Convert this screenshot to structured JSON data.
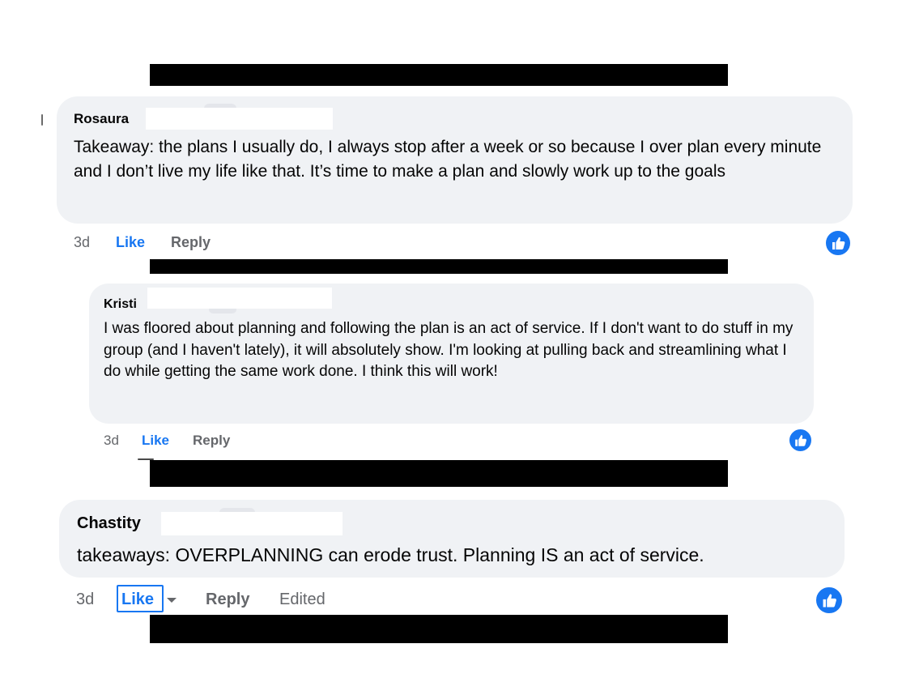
{
  "colors": {
    "bubble": "#f0f2f5",
    "like_blue": "#1877f2",
    "muted": "#65676b",
    "redaction": "#000000"
  },
  "comments": [
    {
      "author": "Rosaura",
      "text": "Takeaway: the plans I usually do, I always stop after a week or so because I over plan every minute and I don’t live my life like that. It’s time to make a plan and slowly work up to the goals",
      "time": "3d",
      "like_label": "Like",
      "reply_label": "Reply",
      "reaction_icon": "thumbs-up-icon"
    },
    {
      "author": "Kristi",
      "text": "I was floored about planning and following the plan is an act of service. If I don't want to do stuff in my group (and I haven't lately), it will absolutely show. I'm looking at pulling back and streamlining what I do while getting the same work done. I think this will work!",
      "time": "3d",
      "like_label": "Like",
      "reply_label": "Reply",
      "reaction_icon": "thumbs-up-icon"
    },
    {
      "author": "Chastity",
      "text": "takeaways: OVERPLANNING can erode trust. Planning IS an act of service.",
      "time": "3d",
      "like_label": "Like",
      "like_menu_icon": "caret-down-icon",
      "reply_label": "Reply",
      "edited_label": "Edited",
      "reaction_icon": "thumbs-up-icon"
    }
  ]
}
